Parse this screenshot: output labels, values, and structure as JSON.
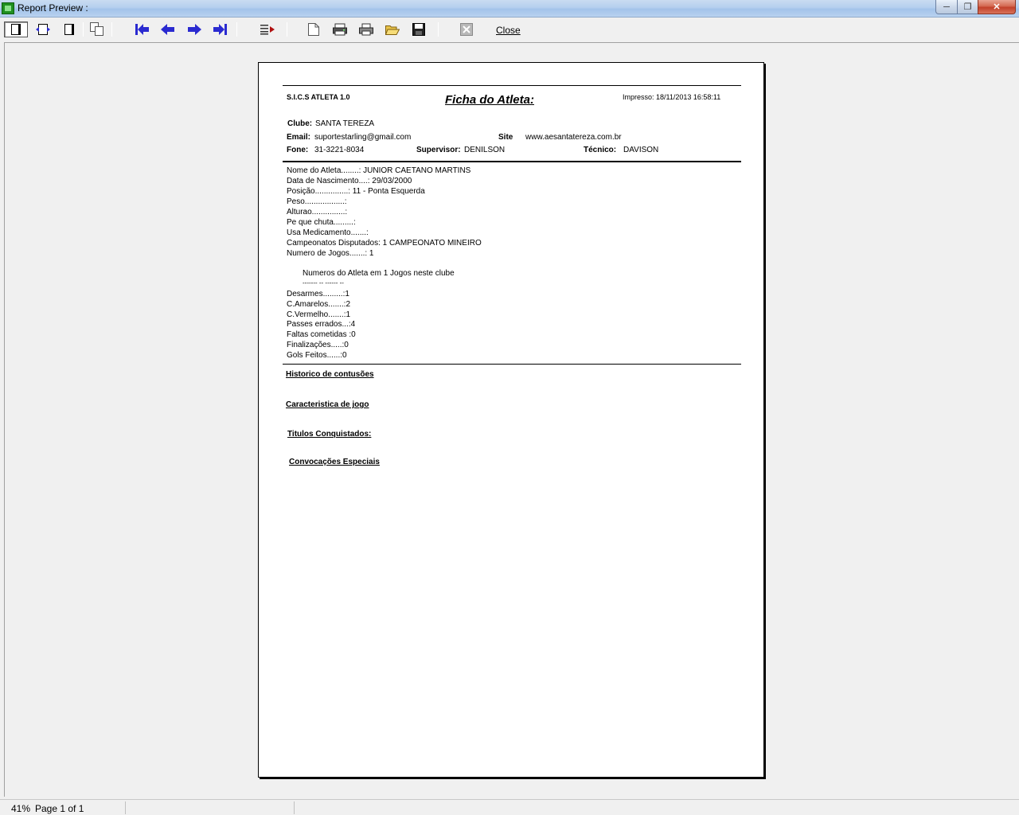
{
  "window": {
    "title": "Report Preview :"
  },
  "toolbar": {
    "buttons": [
      "whole-page",
      "page-width",
      "100-percent",
      "multi-page",
      "first-page",
      "prior-page",
      "next-page",
      "last-page",
      "goto-page",
      "new-page",
      "printer-setup",
      "print",
      "open",
      "save",
      "cancel"
    ],
    "close_label": "Close"
  },
  "report": {
    "system": "S.I.C.S ATLETA 1.0",
    "title": "Ficha do Atleta:",
    "printed": "Impresso: 18/11/2013 16:58:11",
    "clube_label": "Clube:",
    "clube_value": "SANTA TEREZA",
    "email_label": "Email:",
    "email_value": "suportestarling@gmail.com",
    "site_label": "Site",
    "site_value": "www.aesantatereza.com.br",
    "fone_label": "Fone:",
    "fone_value": "31-3221-8034",
    "supervisor_label": "Supervisor:",
    "supervisor_value": "DENILSON",
    "tecnico_label": "Técnico:",
    "tecnico_value": "DAVISON",
    "athlete_lines": [
      "Nome do Atleta........: JUNIOR CAETANO MARTINS",
      "Data de Nascimento....: 29/03/2000",
      "Posição...............: 11 - Ponta Esquerda",
      "Peso..................:",
      "Alturao...............:",
      "Pe que chuta.........:",
      "Usa Medicamento.......:",
      "Campeonatos Disputados: 1 CAMPEONATO MINEIRO",
      "Numero de Jogos.......: 1"
    ],
    "stats_header": "Numeros do Atleta em 1 Jogos neste clube",
    "stats_underline": "------- -- ------ --",
    "stats_lines": [
      "Desarmes.........:1",
      "C.Amarelos.......:2",
      "C.Vermelho.......:1",
      "Passes errados...:4",
      "Faltas cometidas :0",
      "Finalizações.....:0",
      "Gols Feitos......:0"
    ],
    "sections": [
      "Historico de contusões",
      "Caracteristica de jogo",
      "Titulos Conquistados:",
      "Convocações Especiais"
    ]
  },
  "status": {
    "zoom": "41%",
    "page": "Page 1 of 1"
  }
}
